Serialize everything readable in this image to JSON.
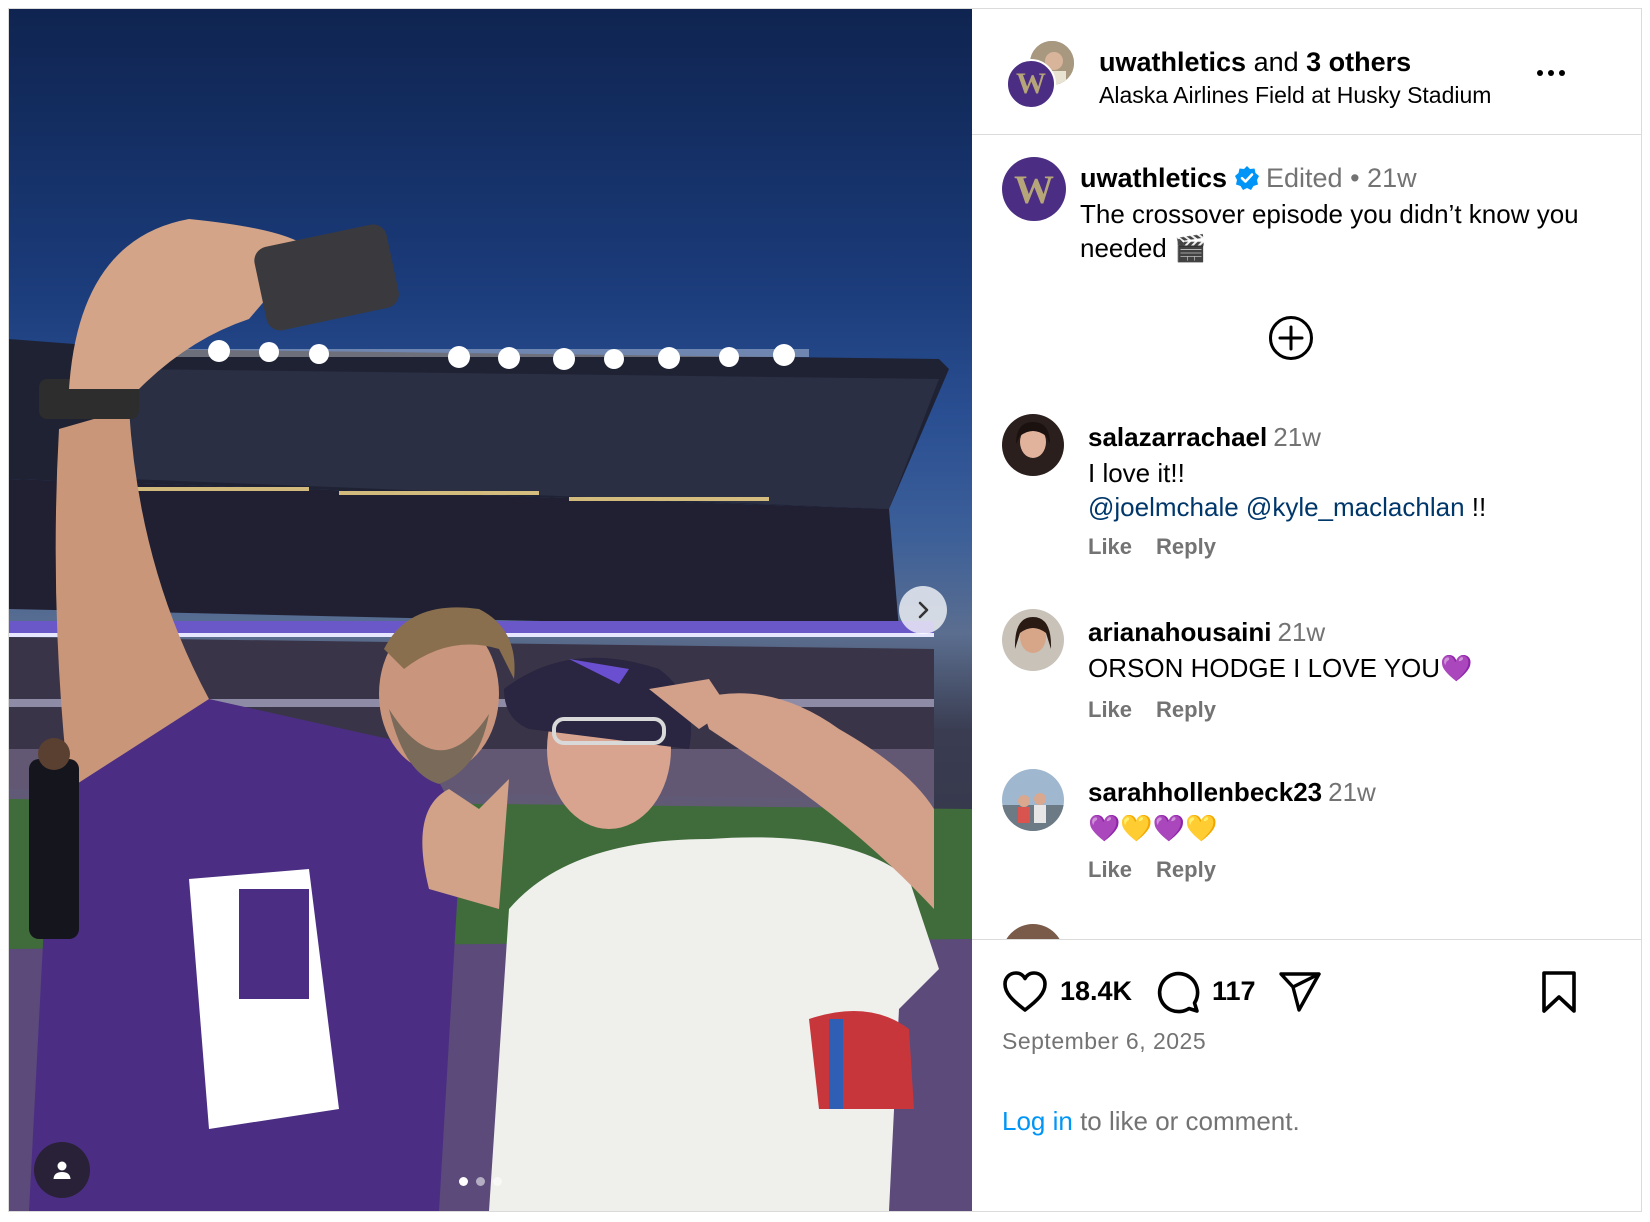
{
  "header": {
    "username": "uwathletics",
    "and_text": "and",
    "others": "3 others",
    "location": "Alaska Airlines Field at Husky Stadium",
    "avatar_letter": "W"
  },
  "caption": {
    "username": "uwathletics",
    "edited": "Edited",
    "separator": "•",
    "time": "21w",
    "text": "The crossover episode you didn’t know you needed 🎬"
  },
  "comments": [
    {
      "username": "salazarrachael",
      "time": "21w",
      "text": "I love it!!",
      "mentions": [
        "@joelmchale",
        "@kyle_maclachlan"
      ],
      "mention_suffix": "!!",
      "like": "Like",
      "reply": "Reply"
    },
    {
      "username": "arianahousaini",
      "time": "21w",
      "text": "ORSON HODGE I LOVE YOU💜",
      "like": "Like",
      "reply": "Reply"
    },
    {
      "username": "sarahhollenbeck23",
      "time": "21w",
      "text": "💜💛💜💛",
      "like": "Like",
      "reply": "Reply"
    }
  ],
  "footer": {
    "likes": "18.4K",
    "comments": "117",
    "date": "September 6, 2025",
    "login_link": "Log in",
    "login_rest": " to like or comment."
  },
  "carousel": {
    "current_slide": 1,
    "total_slides": 3
  },
  "colors": {
    "husky_purple": "#4b2e83",
    "husky_gold": "#b7a57a",
    "link_blue": "#0095f6",
    "mention_blue": "#00376b",
    "muted": "#737373"
  }
}
